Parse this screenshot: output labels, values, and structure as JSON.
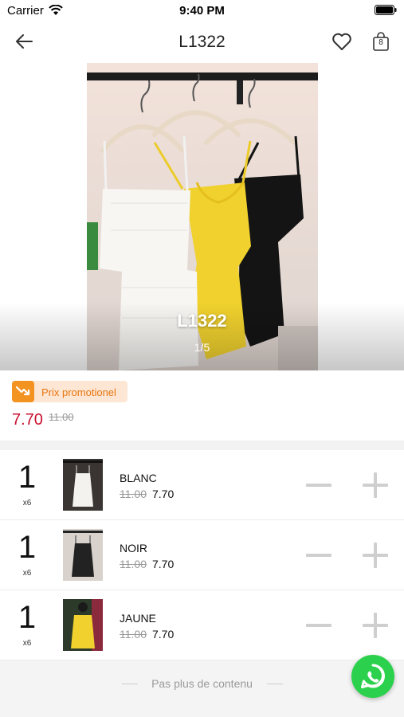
{
  "status_bar": {
    "carrier": "Carrier",
    "time": "9:40 PM"
  },
  "nav": {
    "title": "L1322",
    "cart_count": "8"
  },
  "gallery": {
    "label": "L1322",
    "counter": "1/5"
  },
  "promo": {
    "label": "Prix promotionel",
    "price": "7.70",
    "original_price": "11.00"
  },
  "variants": [
    {
      "qty": "1",
      "multiplier": "x6",
      "name": "BLANC",
      "old_price": "11.00",
      "price": "7.70"
    },
    {
      "qty": "1",
      "multiplier": "x6",
      "name": "NOIR",
      "old_price": "11.00",
      "price": "7.70"
    },
    {
      "qty": "1",
      "multiplier": "x6",
      "name": "JAUNE",
      "old_price": "11.00",
      "price": "7.70"
    }
  ],
  "footer": {
    "text": "Pas plus de contenu"
  },
  "colors": {
    "accent_price": "#c8102e",
    "promo_orange": "#f39322",
    "whatsapp_green": "#2bd14d"
  },
  "icons": [
    "wifi-icon",
    "battery-icon",
    "back-arrow-icon",
    "heart-icon",
    "shopping-bag-icon",
    "trend-down-icon",
    "minus-icon",
    "plus-icon",
    "whatsapp-icon"
  ]
}
